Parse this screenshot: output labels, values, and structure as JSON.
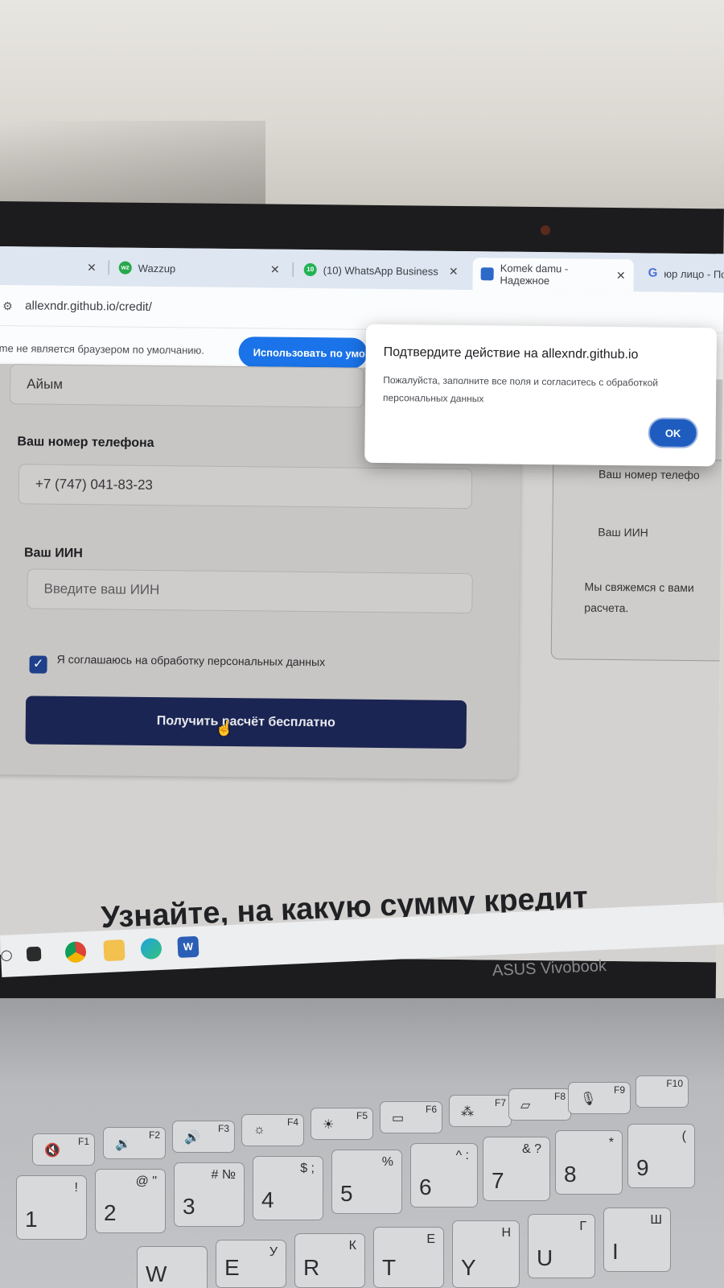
{
  "browser": {
    "tabs": [
      {
        "label": "",
        "icon": "blank-favicon"
      },
      {
        "label": "Wazzup",
        "icon": "wazzup-favicon"
      },
      {
        "label": "(10) WhatsApp Business",
        "icon": "whatsapp-favicon"
      },
      {
        "label": "Komek damu - Надежное",
        "icon": "komek-favicon"
      },
      {
        "label": "юр лицо - Пои",
        "icon": "google-favicon"
      }
    ],
    "url": "allexndr.github.io/credit/",
    "infobar_text": "me не является браузером по умолчанию.",
    "infobar_button": "Использовать по умо"
  },
  "form": {
    "name_value": "Айым",
    "phone_label": "Ваш номер телефона",
    "phone_value": "+7 (747) 041-83-23",
    "iin_label": "Ваш ИИН",
    "iin_placeholder": "Введите ваш ИИН",
    "consent_text": "Я соглашаюсь на обработку персональных данных",
    "consent_checked": true,
    "submit_label": "Получить расчёт бесплатно"
  },
  "side_card": {
    "phone_text": "Ваш номер телефо",
    "iin_text": "Ваш ИИН",
    "note_line1": "Мы свяжемся с вами",
    "note_line2": "расчета."
  },
  "headline": "Узнайте, на какую сумму кредит",
  "dialog": {
    "title": "Подтвердите действие на allexndr.github.io",
    "message": "Пожалуйста, заполните все поля и согласитесь с обработкой персональных данных",
    "ok_label": "OK"
  },
  "laptop_brand": "ASUS Vivobook",
  "keyboard": {
    "fkeys": [
      "F1",
      "F2",
      "F3",
      "F4",
      "F5",
      "F6",
      "F7",
      "F8",
      "F9",
      "F10"
    ],
    "number_row": [
      {
        "main": "1",
        "sub": "!"
      },
      {
        "main": "2",
        "sub": "@ \""
      },
      {
        "main": "3",
        "sub": "# №"
      },
      {
        "main": "4",
        "sub": "$ ;"
      },
      {
        "main": "5",
        "sub": "%"
      },
      {
        "main": "6",
        "sub": "^ :"
      },
      {
        "main": "7",
        "sub": "& ?"
      },
      {
        "main": "8",
        "sub": "*"
      },
      {
        "main": "9",
        "sub": "("
      }
    ],
    "letter_row": [
      {
        "main": "W",
        "sub": ""
      },
      {
        "main": "E",
        "sub": "У"
      },
      {
        "main": "R",
        "sub": "К"
      },
      {
        "main": "T",
        "sub": "Е"
      },
      {
        "main": "Y",
        "sub": "Н"
      },
      {
        "main": "U",
        "sub": "Г"
      },
      {
        "main": "I",
        "sub": "Ш"
      }
    ]
  }
}
